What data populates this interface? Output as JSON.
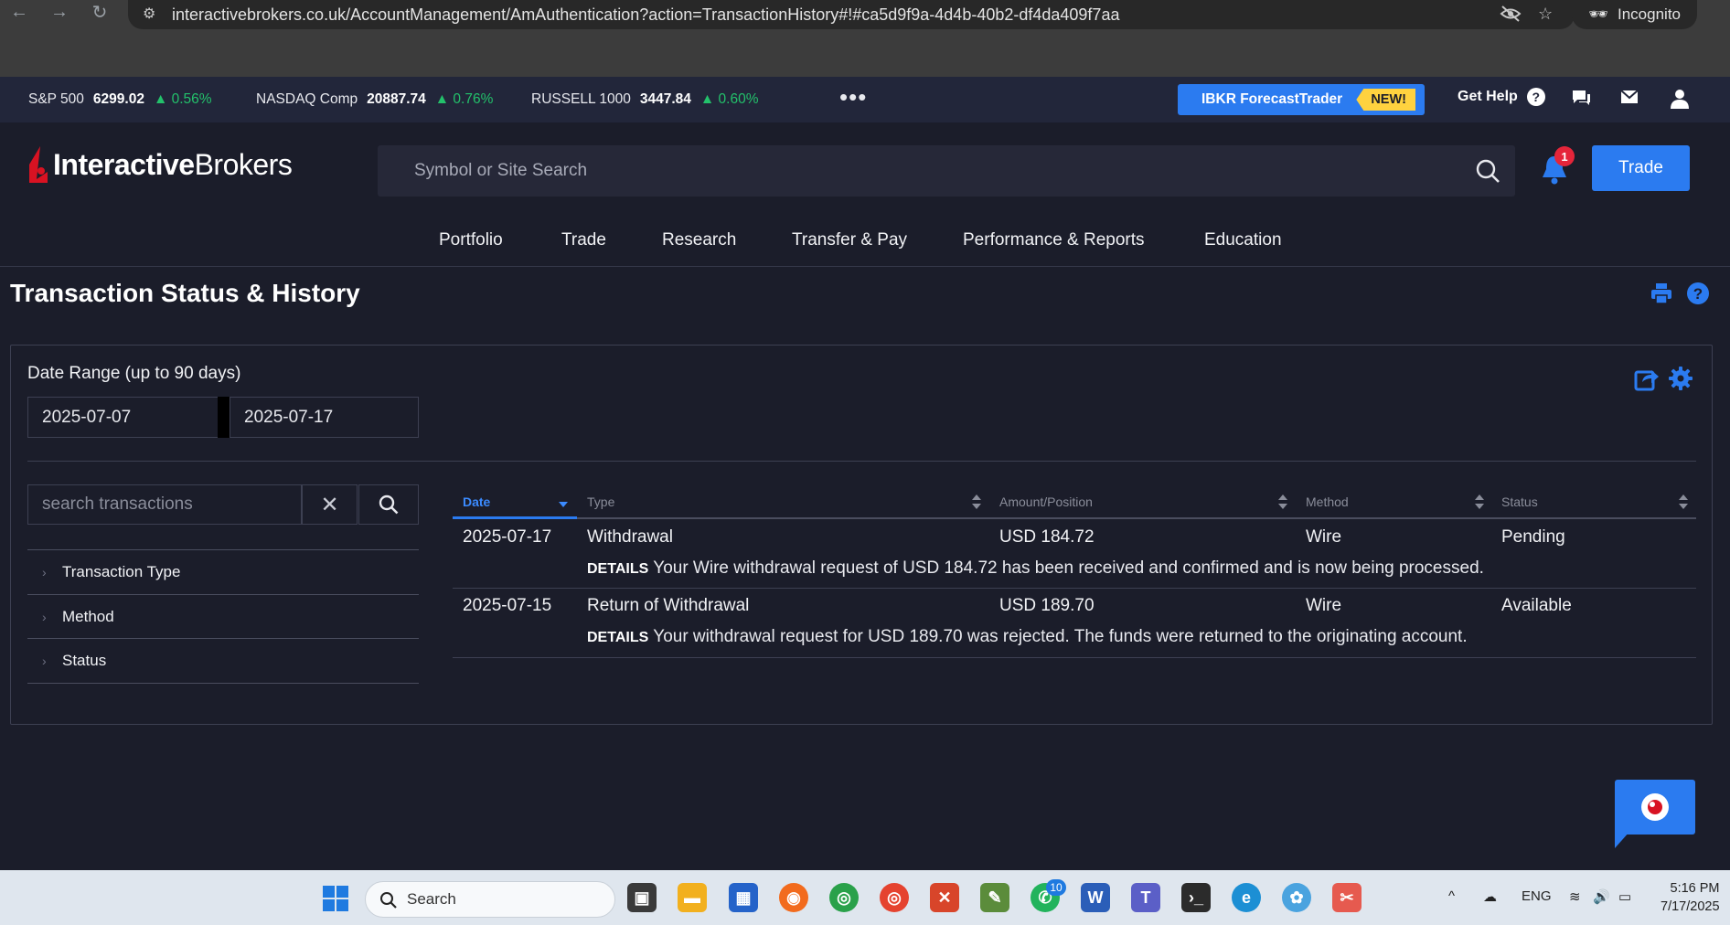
{
  "browser": {
    "url": "interactivebrokers.co.uk/AccountManagement/AmAuthentication?action=TransactionHistory#!#ca5d9f9a-4d4b-40b2-df4da409f7aa",
    "mode_label": "Incognito"
  },
  "ticker": [
    {
      "name": "S&P 500",
      "value": "6299.02",
      "change": "▲ 0.56%"
    },
    {
      "name": "NASDAQ Comp",
      "value": "20887.74",
      "change": "▲ 0.76%"
    },
    {
      "name": "RUSSELL 1000",
      "value": "3447.84",
      "change": "▲ 0.60%"
    }
  ],
  "promo": {
    "label": "IBKR ForecastTrader",
    "tag": "NEW!"
  },
  "help": {
    "label": "Get Help"
  },
  "logo": {
    "part1": "Interactive",
    "part2": "Brokers"
  },
  "site_search": {
    "placeholder": "Symbol or Site Search"
  },
  "notifications": {
    "count": "1"
  },
  "trade_button": "Trade",
  "nav": [
    "Portfolio",
    "Trade",
    "Research",
    "Transfer & Pay",
    "Performance & Reports",
    "Education"
  ],
  "page": {
    "title": "Transaction Status & History"
  },
  "date_range": {
    "label": "Date Range (up to 90 days)",
    "from": "2025-07-07",
    "to": "2025-07-17"
  },
  "tx_search": {
    "placeholder": "search transactions"
  },
  "filters": [
    "Transaction Type",
    "Method",
    "Status"
  ],
  "table": {
    "columns": [
      "Date",
      "Type",
      "Amount/Position",
      "Method",
      "Status"
    ],
    "details_label": "DETAILS",
    "rows": [
      {
        "date": "2025-07-17",
        "type": "Withdrawal",
        "amount": "USD 184.72",
        "method": "Wire",
        "status": "Pending",
        "details": "Your Wire withdrawal request of USD 184.72 has been received and confirmed and is now being processed."
      },
      {
        "date": "2025-07-15",
        "type": "Return of Withdrawal",
        "amount": "USD 189.70",
        "method": "Wire",
        "status": "Available",
        "details": "Your withdrawal request for USD 189.70 was rejected. The funds were returned to the originating account."
      }
    ]
  },
  "taskbar": {
    "search_label": "Search",
    "whatsapp_badge": "10",
    "language": "ENG",
    "time": "5:16 PM",
    "date": "7/17/2025"
  },
  "colors": {
    "accent": "#2b7bf0",
    "positive": "#23c16b",
    "background": "#1b1d2a"
  }
}
